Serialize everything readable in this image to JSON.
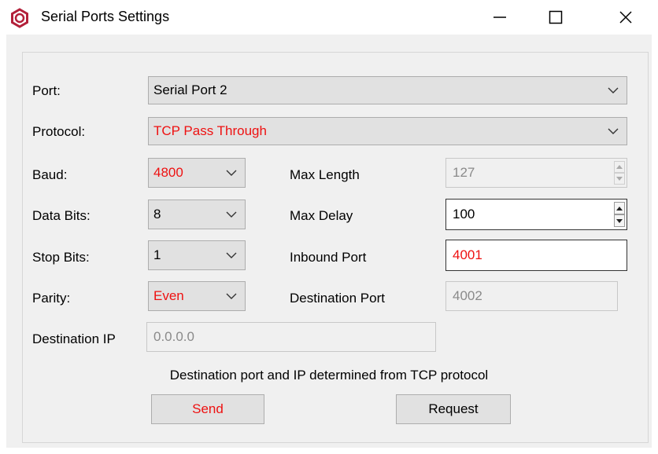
{
  "window": {
    "title": "Serial Ports Settings",
    "icon": "app-logo-icon",
    "controls": [
      "minimize-icon",
      "maximize-icon",
      "close-icon"
    ]
  },
  "labels": {
    "port": "Port:",
    "protocol": "Protocol:",
    "baud": "Baud:",
    "data_bits": "Data Bits:",
    "stop_bits": "Stop Bits:",
    "parity": "Parity:",
    "destination_ip": "Destination IP",
    "max_length": "Max Length",
    "max_delay": "Max Delay",
    "inbound_port": "Inbound Port",
    "destination_port": "Destination Port"
  },
  "values": {
    "port": "Serial Port 2",
    "protocol": "TCP Pass Through",
    "baud": "4800",
    "data_bits": "8",
    "stop_bits": "1",
    "parity": "Even",
    "destination_ip": "0.0.0.0",
    "max_length": "127",
    "max_delay": "100",
    "inbound_port": "4001",
    "destination_port": "4002"
  },
  "note": "Destination port and IP determined from TCP protocol",
  "buttons": {
    "send": "Send",
    "request": "Request"
  },
  "colors": {
    "modified_text": "#ee1111",
    "panel_bg": "#f0f0f0"
  }
}
